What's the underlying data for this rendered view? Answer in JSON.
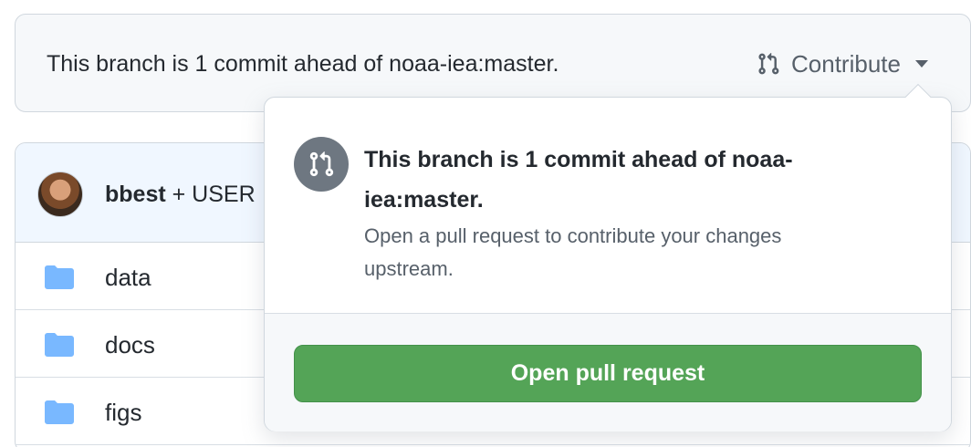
{
  "branch_bar": {
    "status_text": "This branch is 1 commit ahead of noaa-iea:master.",
    "contribute_label": "Contribute"
  },
  "commit_header": {
    "user": "bbest",
    "suffix": " + USER"
  },
  "files": [
    {
      "name": "data",
      "type": "folder"
    },
    {
      "name": "docs",
      "type": "folder"
    },
    {
      "name": "figs",
      "type": "folder"
    }
  ],
  "popover": {
    "title": "This branch is 1 commit ahead of noaa-iea:master.",
    "description": "Open a pull request to contribute your changes upstream.",
    "button_label": "Open pull request"
  },
  "colors": {
    "primary_button": "#54a457",
    "folder": "#79b8ff",
    "icon_circle": "#6e7781"
  }
}
